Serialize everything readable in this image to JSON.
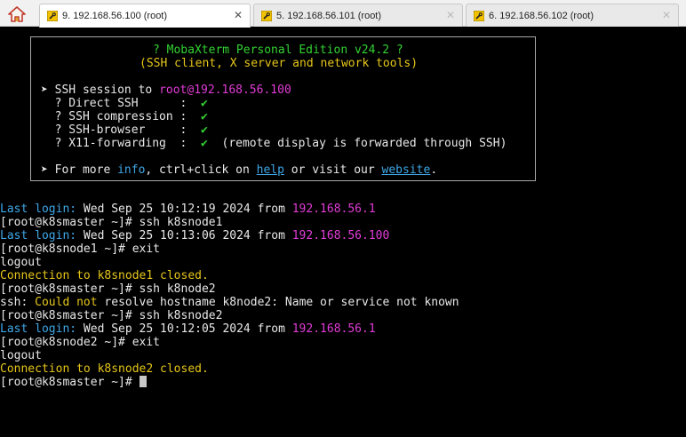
{
  "tabs": [
    {
      "label": "9. 192.168.56.100 (root)",
      "active": true
    },
    {
      "label": "5. 192.168.56.101 (root)",
      "active": false
    },
    {
      "label": "6. 192.168.56.102 (root)",
      "active": false
    }
  ],
  "banner": {
    "title": "? MobaXterm Personal Edition v24.2 ?",
    "subtitle": "(SSH client, X server and network tools)",
    "session_prefix": "➤ SSH session to ",
    "session_target": "root@192.168.56.100",
    "opts": [
      {
        "label": "  ? Direct SSH      :  ",
        "mark": "✔",
        "note": ""
      },
      {
        "label": "  ? SSH compression :  ",
        "mark": "✔",
        "note": ""
      },
      {
        "label": "  ? SSH-browser     :  ",
        "mark": "✔",
        "note": ""
      },
      {
        "label": "  ? X11-forwarding  :  ",
        "mark": "✔",
        "note": "  (remote display is forwarded through SSH)"
      }
    ],
    "more_prefix": "➤ For more ",
    "info": "info",
    "more_mid": ", ctrl+click on ",
    "help": "help",
    "more_mid2": " or visit our ",
    "website": "website",
    "more_end": "."
  },
  "lines": [
    {
      "parts": [
        {
          "t": "Last login:",
          "c": "c"
        },
        {
          "t": " Wed Sep 25 10:12:19 2024 from ",
          "c": "w"
        },
        {
          "t": "192.168.56.1",
          "c": "m"
        }
      ]
    },
    {
      "parts": [
        {
          "t": "[root@k8smaster ~]# ssh k8snode1",
          "c": "w"
        }
      ]
    },
    {
      "parts": [
        {
          "t": "Last login:",
          "c": "c"
        },
        {
          "t": " Wed Sep 25 10:13:06 2024 from ",
          "c": "w"
        },
        {
          "t": "192.168.56.100",
          "c": "m"
        }
      ]
    },
    {
      "parts": [
        {
          "t": "[root@k8snode1 ~]# exit",
          "c": "w"
        }
      ]
    },
    {
      "parts": [
        {
          "t": "logout",
          "c": "w"
        }
      ]
    },
    {
      "parts": [
        {
          "t": "Connection to k8snode1 closed.",
          "c": "y"
        }
      ]
    },
    {
      "parts": [
        {
          "t": "[root@k8smaster ~]# ssh k8node2",
          "c": "w"
        }
      ]
    },
    {
      "parts": [
        {
          "t": "ssh: ",
          "c": "w"
        },
        {
          "t": "Could not",
          "c": "y"
        },
        {
          "t": " resolve hostname k8node2: Name or service not known",
          "c": "w"
        }
      ]
    },
    {
      "parts": [
        {
          "t": "[root@k8smaster ~]# ssh k8snode2",
          "c": "w"
        }
      ]
    },
    {
      "parts": [
        {
          "t": "Last login:",
          "c": "c"
        },
        {
          "t": " Wed Sep 25 10:12:05 2024 from ",
          "c": "w"
        },
        {
          "t": "192.168.56.1",
          "c": "m"
        }
      ]
    },
    {
      "parts": [
        {
          "t": "[root@k8snode2 ~]# exit",
          "c": "w"
        }
      ]
    },
    {
      "parts": [
        {
          "t": "logout",
          "c": "w"
        }
      ]
    },
    {
      "parts": [
        {
          "t": "Connection to k8snode2 closed.",
          "c": "y"
        }
      ]
    }
  ],
  "prompt": "[root@k8smaster ~]# "
}
